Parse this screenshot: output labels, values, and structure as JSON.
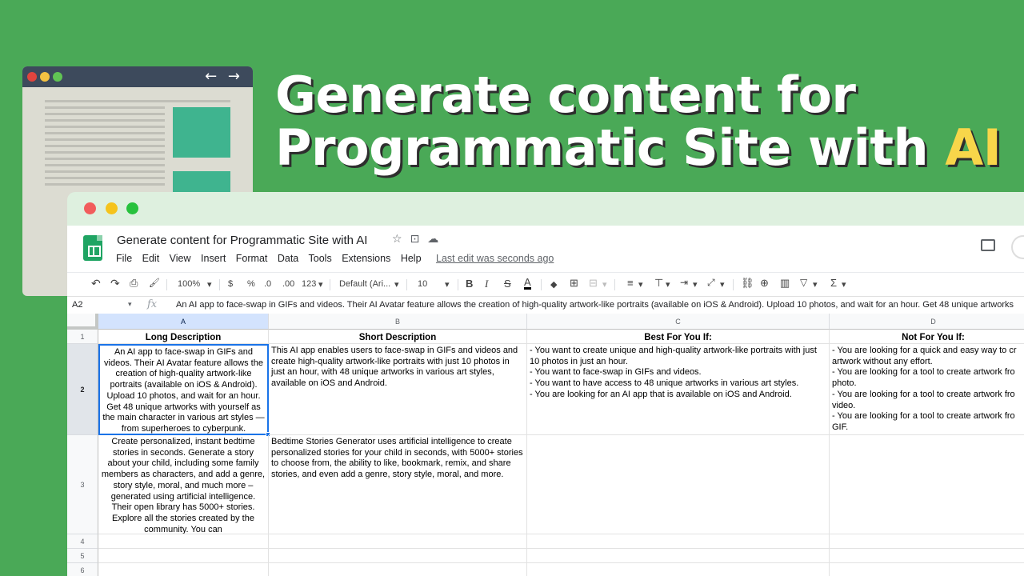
{
  "headline": {
    "line1": "Generate content for",
    "line2_prefix": "Programmatic Site with ",
    "line2_highlight": "AI"
  },
  "colors": {
    "background": "#4aa957",
    "highlight": "#f7d64a",
    "selection": "#1a73e8",
    "sheets_green": "#1fa463"
  },
  "browser_mock": {
    "nav_arrows": "← →"
  },
  "app": {
    "title": "Generate content for Programmatic Site with AI",
    "title_icons": [
      "star-icon",
      "move-to-folder-icon",
      "cloud-status-icon"
    ],
    "menus": [
      "File",
      "Edit",
      "View",
      "Insert",
      "Format",
      "Data",
      "Tools",
      "Extensions",
      "Help"
    ],
    "last_edit": "Last edit was seconds ago"
  },
  "toolbar": {
    "undo": "↶",
    "redo": "↷",
    "print": "⎙",
    "paint_format": "🖌",
    "zoom": "100%",
    "currency": "$",
    "percent": "%",
    "decimal_decrease": ".0",
    "decimal_increase": ".00",
    "more_formats": "123",
    "font": "Default (Ari...",
    "font_size": "10",
    "bold": "B",
    "italic": "I",
    "strikethrough": "S",
    "text_color": "A",
    "caret": "▾"
  },
  "formula_bar": {
    "cell_ref": "A2",
    "fx": "fx",
    "content": "An AI app to face-swap in GIFs and videos. Their AI Avatar feature allows the creation of high-quality artwork-like portraits (available on iOS & Android). Upload 10 photos, and wait for an hour. Get 48 unique artworks"
  },
  "grid": {
    "columns": [
      "A",
      "B",
      "C",
      "D"
    ],
    "rows": [
      "1",
      "2",
      "3",
      "4",
      "5",
      "6"
    ],
    "headers": [
      "Long Description",
      "Short Description",
      "Best For You If:",
      "Not For You If:"
    ],
    "row2": {
      "a": "An AI app to face-swap in GIFs and videos. Their AI Avatar feature allows the creation of high-quality artwork-like portraits (available on iOS & Android). Upload 10 photos, and wait for an hour. Get 48 unique artworks with yourself as the main character in various art styles — from superheroes to cyberpunk.",
      "b": "This AI app enables users to face-swap in GIFs and videos and create high-quality artwork-like portraits with just 10 photos in just an hour, with 48 unique artworks in various art styles, available on iOS and Android.",
      "c": "- You want to create unique and high-quality artwork-like portraits with just 10 photos in just an hour.\n- You want to face-swap in GIFs and videos.\n- You want to have access to 48 unique artworks in various art styles.\n- You are looking for an AI app that is available on iOS and Android.",
      "d": "- You are looking for a quick and easy way to cr\nartwork without any effort.\n- You are looking for a tool to create artwork fro\nphoto.\n- You are looking for a tool to create artwork fro\nvideo.\n- You are looking for a tool to create artwork fro\nGIF."
    },
    "row3": {
      "a": "Create personalized, instant bedtime stories in seconds. Generate a story about your child, including some family members as characters, and add a genre, story style, moral, and much more – generated using artificial intelligence. Their open library has 5000+ stories. Explore all the stories created by the community. You can",
      "b": "Bedtime Stories Generator uses artificial intelligence to create personalized stories for your child in seconds, with 5000+ stories to choose from, the ability to like, bookmark, remix, and share stories, and even add a genre, story style, moral, and more."
    }
  }
}
